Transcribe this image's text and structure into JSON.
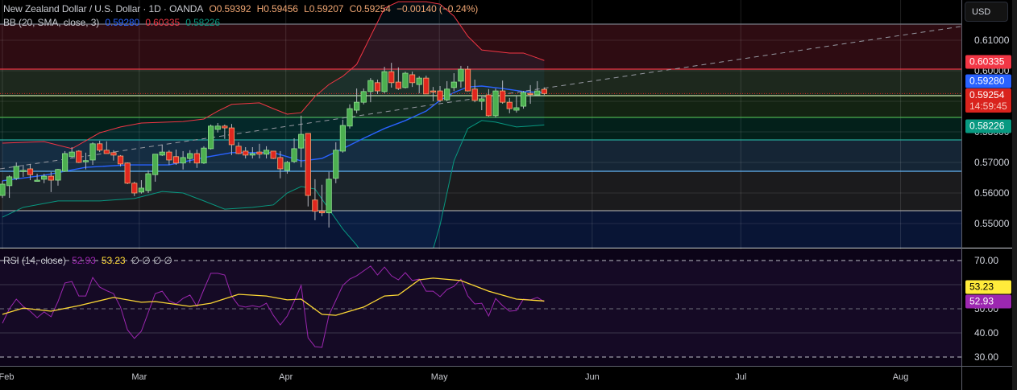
{
  "header": {
    "symbol": "New Zealand Dollar / U.S. Dollar · 1D · OANDA",
    "open": "O0.59392",
    "high": "H0.59456",
    "low": "L0.59207",
    "close": "C0.59254",
    "change": "−0.00140 (−0.24%)"
  },
  "bb_legend": {
    "label": "BB (20, SMA, close, 3)",
    "basis": "0.59280",
    "upper": "0.60335",
    "lower": "0.58226"
  },
  "rsi_legend": {
    "label": "RSI (14, close)",
    "rsi": "52.93",
    "ma": "53.23",
    "empty": "∅ ∅ ∅ ∅"
  },
  "currency_button": "USD",
  "price_axis": {
    "ticks": [
      "0.61000",
      "0.60000",
      "0.58000",
      "0.57000",
      "0.56000",
      "0.55000"
    ],
    "tick_values": [
      0.61,
      0.6,
      0.58,
      0.57,
      0.56,
      0.55
    ],
    "badges": {
      "bb_upper": "0.60335",
      "bb_basis": "0.59280",
      "last_price": "0.59254",
      "countdown": "14:59:45",
      "bb_lower": "0.58226"
    }
  },
  "rsi_axis": {
    "ticks": [
      "70.00",
      "50.00",
      "40.00",
      "30.00"
    ],
    "tick_values": [
      70,
      50,
      40,
      30
    ],
    "badges": {
      "ma": "53.23",
      "rsi": "52.93"
    }
  },
  "colors": {
    "up": "#4caf50",
    "down": "#e0271f",
    "bb_basis": "#2962ff",
    "bb_upper": "#f23645",
    "bb_lower": "#089981",
    "rsi": "#9c27b0",
    "rsi_ma": "#fdd835",
    "last_price": "#e0271f"
  },
  "chart_data": {
    "type": "candlestick",
    "title": "New Zealand Dollar / U.S. Dollar · 1D · OANDA",
    "ylim": [
      0.545,
      0.623
    ],
    "months": [
      {
        "label": "Feb",
        "index": 1
      },
      {
        "label": "Mar",
        "index": 20.7
      },
      {
        "label": "Apr",
        "index": 41.8
      },
      {
        "label": "May",
        "index": 63.9
      },
      {
        "label": "Jun",
        "index": 85.9
      },
      {
        "label": "Jul",
        "index": 107.3
      },
      {
        "label": "Aug",
        "index": 130.3
      }
    ],
    "candles_ohlc": [
      [
        0.5592,
        0.564,
        0.5584,
        0.5629
      ],
      [
        0.5624,
        0.5658,
        0.5584,
        0.5653
      ],
      [
        0.5648,
        0.57,
        0.5642,
        0.5687
      ],
      [
        0.5671,
        0.5692,
        0.5653,
        0.5674
      ],
      [
        0.5679,
        0.5695,
        0.5642,
        0.566
      ],
      [
        0.564,
        0.5663,
        0.5637,
        0.5642
      ],
      [
        0.5645,
        0.5663,
        0.5632,
        0.5655
      ],
      [
        0.5655,
        0.5669,
        0.5603,
        0.5642
      ],
      [
        0.5642,
        0.5679,
        0.5624,
        0.5677
      ],
      [
        0.5671,
        0.5737,
        0.5669,
        0.5729
      ],
      [
        0.5719,
        0.575,
        0.5716,
        0.5734
      ],
      [
        0.5737,
        0.574,
        0.5698,
        0.57
      ],
      [
        0.5703,
        0.5732,
        0.5677,
        0.5706
      ],
      [
        0.5708,
        0.5766,
        0.5692,
        0.5761
      ],
      [
        0.5761,
        0.5771,
        0.5734,
        0.574
      ],
      [
        0.574,
        0.5769,
        0.5729,
        0.5729
      ],
      [
        0.5732,
        0.574,
        0.5706,
        0.5724
      ],
      [
        0.5721,
        0.5724,
        0.5687,
        0.5695
      ],
      [
        0.5698,
        0.57,
        0.5629,
        0.5632
      ],
      [
        0.5632,
        0.5637,
        0.559,
        0.56
      ],
      [
        0.5603,
        0.5642,
        0.5598,
        0.5616
      ],
      [
        0.5608,
        0.5674,
        0.56,
        0.5663
      ],
      [
        0.566,
        0.5727,
        0.5637,
        0.5727
      ],
      [
        0.5724,
        0.5758,
        0.5721,
        0.5734
      ],
      [
        0.5734,
        0.574,
        0.5692,
        0.5708
      ],
      [
        0.5719,
        0.5742,
        0.5692,
        0.5698
      ],
      [
        0.5698,
        0.5737,
        0.5677,
        0.5716
      ],
      [
        0.5713,
        0.574,
        0.5698,
        0.5729
      ],
      [
        0.5729,
        0.5742,
        0.5682,
        0.5698
      ],
      [
        0.5698,
        0.5753,
        0.5695,
        0.5747
      ],
      [
        0.5745,
        0.5824,
        0.5742,
        0.5819
      ],
      [
        0.5808,
        0.5829,
        0.5798,
        0.5819
      ],
      [
        0.5819,
        0.5824,
        0.5777,
        0.5813
      ],
      [
        0.5813,
        0.5826,
        0.5724,
        0.5758
      ],
      [
        0.5753,
        0.5766,
        0.5727,
        0.5729
      ],
      [
        0.5737,
        0.575,
        0.5713,
        0.5724
      ],
      [
        0.5724,
        0.575,
        0.5713,
        0.5729
      ],
      [
        0.5734,
        0.5761,
        0.5713,
        0.5727
      ],
      [
        0.5727,
        0.5753,
        0.5713,
        0.574
      ],
      [
        0.5737,
        0.5737,
        0.5711,
        0.5713
      ],
      [
        0.5716,
        0.5737,
        0.5648,
        0.5679
      ],
      [
        0.5674,
        0.5705,
        0.5663,
        0.57
      ],
      [
        0.5703,
        0.5779,
        0.5698,
        0.5745
      ],
      [
        0.5747,
        0.5853,
        0.5684,
        0.5792
      ],
      [
        0.5795,
        0.5795,
        0.5556,
        0.5592
      ],
      [
        0.5577,
        0.5645,
        0.5511,
        0.554
      ],
      [
        0.554,
        0.5627,
        0.5524,
        0.5535
      ],
      [
        0.5535,
        0.5669,
        0.5487,
        0.5645
      ],
      [
        0.5648,
        0.5766,
        0.5632,
        0.574
      ],
      [
        0.5737,
        0.584,
        0.5732,
        0.5821
      ],
      [
        0.5819,
        0.589,
        0.5811,
        0.5876
      ],
      [
        0.5871,
        0.5942,
        0.5861,
        0.5897
      ],
      [
        0.5897,
        0.5942,
        0.589,
        0.5932
      ],
      [
        0.5932,
        0.5976,
        0.5897,
        0.5968
      ],
      [
        0.5961,
        0.5971,
        0.5924,
        0.5934
      ],
      [
        0.5932,
        0.6013,
        0.5926,
        0.5997
      ],
      [
        0.5997,
        0.6026,
        0.5945,
        0.5961
      ],
      [
        0.5963,
        0.6011,
        0.5937,
        0.5942
      ],
      [
        0.5945,
        0.5997,
        0.5942,
        0.5992
      ],
      [
        0.5987,
        0.5997,
        0.5947,
        0.5961
      ],
      [
        0.5955,
        0.5982,
        0.5926,
        0.5976
      ],
      [
        0.5976,
        0.5984,
        0.5924,
        0.5924
      ],
      [
        0.5934,
        0.5947,
        0.59,
        0.5932
      ],
      [
        0.5934,
        0.595,
        0.5897,
        0.5903
      ],
      [
        0.5905,
        0.5966,
        0.59,
        0.594
      ],
      [
        0.5945,
        0.5992,
        0.5934,
        0.5963
      ],
      [
        0.5966,
        0.6016,
        0.5945,
        0.6005
      ],
      [
        0.6005,
        0.6016,
        0.5932,
        0.5934
      ],
      [
        0.594,
        0.5971,
        0.5897,
        0.5903
      ],
      [
        0.59,
        0.5916,
        0.5871,
        0.5908
      ],
      [
        0.5921,
        0.594,
        0.585,
        0.5853
      ],
      [
        0.5853,
        0.5942,
        0.5847,
        0.5934
      ],
      [
        0.5934,
        0.5968,
        0.5892,
        0.5897
      ],
      [
        0.5897,
        0.5911,
        0.5861,
        0.5876
      ],
      [
        0.5871,
        0.5918,
        0.5863,
        0.5879
      ],
      [
        0.5884,
        0.5934,
        0.5876,
        0.5929
      ],
      [
        0.5926,
        0.5953,
        0.5892,
        0.5924
      ],
      [
        0.5921,
        0.5966,
        0.5918,
        0.5934
      ],
      [
        0.59392,
        0.59456,
        0.59207,
        0.59254
      ]
    ],
    "bb_upper": [
      [
        1,
        0.5763
      ],
      [
        7,
        0.5768
      ],
      [
        11,
        0.5745
      ],
      [
        13,
        0.5771
      ],
      [
        15,
        0.5797
      ],
      [
        18,
        0.5816
      ],
      [
        21,
        0.5829
      ],
      [
        27,
        0.5834
      ],
      [
        30,
        0.5842
      ],
      [
        32,
        0.5868
      ],
      [
        34,
        0.589
      ],
      [
        38,
        0.5895
      ],
      [
        40,
        0.5876
      ],
      [
        42,
        0.5858
      ],
      [
        44,
        0.5863
      ],
      [
        46,
        0.5916
      ],
      [
        48,
        0.5955
      ],
      [
        50,
        0.5982
      ],
      [
        52,
        0.6021
      ],
      [
        54,
        0.6113
      ],
      [
        56,
        0.6205
      ],
      [
        58,
        0.6226
      ],
      [
        62,
        0.6226
      ],
      [
        64,
        0.6218
      ],
      [
        66,
        0.6179
      ],
      [
        68,
        0.6113
      ],
      [
        70,
        0.6068
      ],
      [
        74,
        0.6058
      ],
      [
        76,
        0.6058
      ],
      [
        78,
        0.6042
      ],
      [
        79,
        0.60335
      ]
    ],
    "bb_basis": [
      [
        1,
        0.564
      ],
      [
        7,
        0.5658
      ],
      [
        13,
        0.5684
      ],
      [
        19,
        0.5692
      ],
      [
        25,
        0.5692
      ],
      [
        30,
        0.5716
      ],
      [
        34,
        0.5732
      ],
      [
        40,
        0.5732
      ],
      [
        42,
        0.5719
      ],
      [
        44,
        0.5705
      ],
      [
        47,
        0.5713
      ],
      [
        50,
        0.5745
      ],
      [
        53,
        0.5779
      ],
      [
        56,
        0.5811
      ],
      [
        59,
        0.5837
      ],
      [
        62,
        0.5868
      ],
      [
        64,
        0.5903
      ],
      [
        66,
        0.5929
      ],
      [
        68,
        0.5947
      ],
      [
        70,
        0.595
      ],
      [
        73,
        0.5942
      ],
      [
        76,
        0.5932
      ],
      [
        79,
        0.5928
      ]
    ],
    "bb_lower": [
      [
        1,
        0.5521
      ],
      [
        4,
        0.5553
      ],
      [
        9,
        0.5574
      ],
      [
        15,
        0.5574
      ],
      [
        20,
        0.5582
      ],
      [
        24,
        0.5605
      ],
      [
        27,
        0.56
      ],
      [
        30,
        0.5574
      ],
      [
        33,
        0.5547
      ],
      [
        37,
        0.5553
      ],
      [
        40,
        0.5561
      ],
      [
        42,
        0.56
      ],
      [
        44,
        0.5621
      ],
      [
        46,
        0.5613
      ],
      [
        48,
        0.5547
      ],
      [
        50,
        0.5482
      ],
      [
        52,
        0.5429
      ],
      [
        54,
        0.5363
      ],
      [
        60,
        0.5324
      ],
      [
        63,
        0.5416
      ],
      [
        64,
        0.5495
      ],
      [
        66,
        0.5705
      ],
      [
        68,
        0.5811
      ],
      [
        70,
        0.5837
      ],
      [
        72,
        0.5832
      ],
      [
        75,
        0.5816
      ],
      [
        77,
        0.5819
      ],
      [
        79,
        0.58226
      ]
    ],
    "fib_levels": [
      {
        "price": 0.61526,
        "line": "#787b86",
        "fill": "#2e0c12"
      },
      {
        "price": 0.60053,
        "line": "#f23645",
        "fill": "#1d281d"
      },
      {
        "price": 0.59184,
        "line": "#c5e1a5",
        "fill": "#132312"
      },
      {
        "price": 0.58474,
        "line": "#4caf50",
        "fill": "#03201a"
      },
      {
        "price": 0.57737,
        "line": "#26a69a",
        "fill": "#152535"
      },
      {
        "price": 0.56711,
        "line": "#64b5f6",
        "fill": "#1b1b1d"
      },
      {
        "price": 0.55421,
        "line": "#9e9e9e",
        "fill": "#091535"
      }
    ],
    "trendline": [
      [
        0.65,
        0.5679
      ],
      [
        139,
        0.6145
      ]
    ],
    "last_price": 0.59254,
    "rsi": [
      44,
      50,
      54,
      51,
      49,
      46.3,
      48.7,
      46.7,
      53,
      60.7,
      61.3,
      55.3,
      55.3,
      63,
      59,
      57.5,
      56.3,
      50.7,
      41.3,
      37.7,
      40.7,
      48.5,
      56.3,
      57.3,
      53.3,
      52,
      54.3,
      55.7,
      51,
      58,
      64.7,
      64.7,
      64,
      55.3,
      51.3,
      50.7,
      51.3,
      50.7,
      52.3,
      47.3,
      43.3,
      47,
      53,
      59.7,
      38,
      34.3,
      34,
      47.3,
      53.5,
      59.7,
      62.3,
      63.7,
      65.7,
      67.7,
      64,
      67.3,
      63.7,
      62,
      65,
      61.7,
      62.3,
      57.3,
      57.3,
      55,
      58,
      59.3,
      62.3,
      55.3,
      52,
      52.3,
      47,
      54.3,
      51.3,
      49,
      49.3,
      54,
      53.7,
      54.7,
      52.93
    ],
    "rsi_ma": [
      [
        1,
        47.7
      ],
      [
        4,
        50.3
      ],
      [
        8,
        49
      ],
      [
        12,
        51.3
      ],
      [
        17,
        54.7
      ],
      [
        21,
        52.7
      ],
      [
        23,
        53
      ],
      [
        28,
        51
      ],
      [
        31,
        52.3
      ],
      [
        35,
        56
      ],
      [
        39,
        55.3
      ],
      [
        42,
        53.7
      ],
      [
        44,
        54
      ],
      [
        47,
        47.7
      ],
      [
        49,
        47.3
      ],
      [
        53,
        50.7
      ],
      [
        56,
        55.3
      ],
      [
        58,
        55.7
      ],
      [
        61,
        62
      ],
      [
        63,
        62.7
      ],
      [
        67,
        61.7
      ],
      [
        71,
        57.3
      ],
      [
        75,
        54
      ],
      [
        79,
        53.23
      ]
    ],
    "rsi_levels": [
      70,
      60,
      50,
      40,
      30
    ]
  }
}
